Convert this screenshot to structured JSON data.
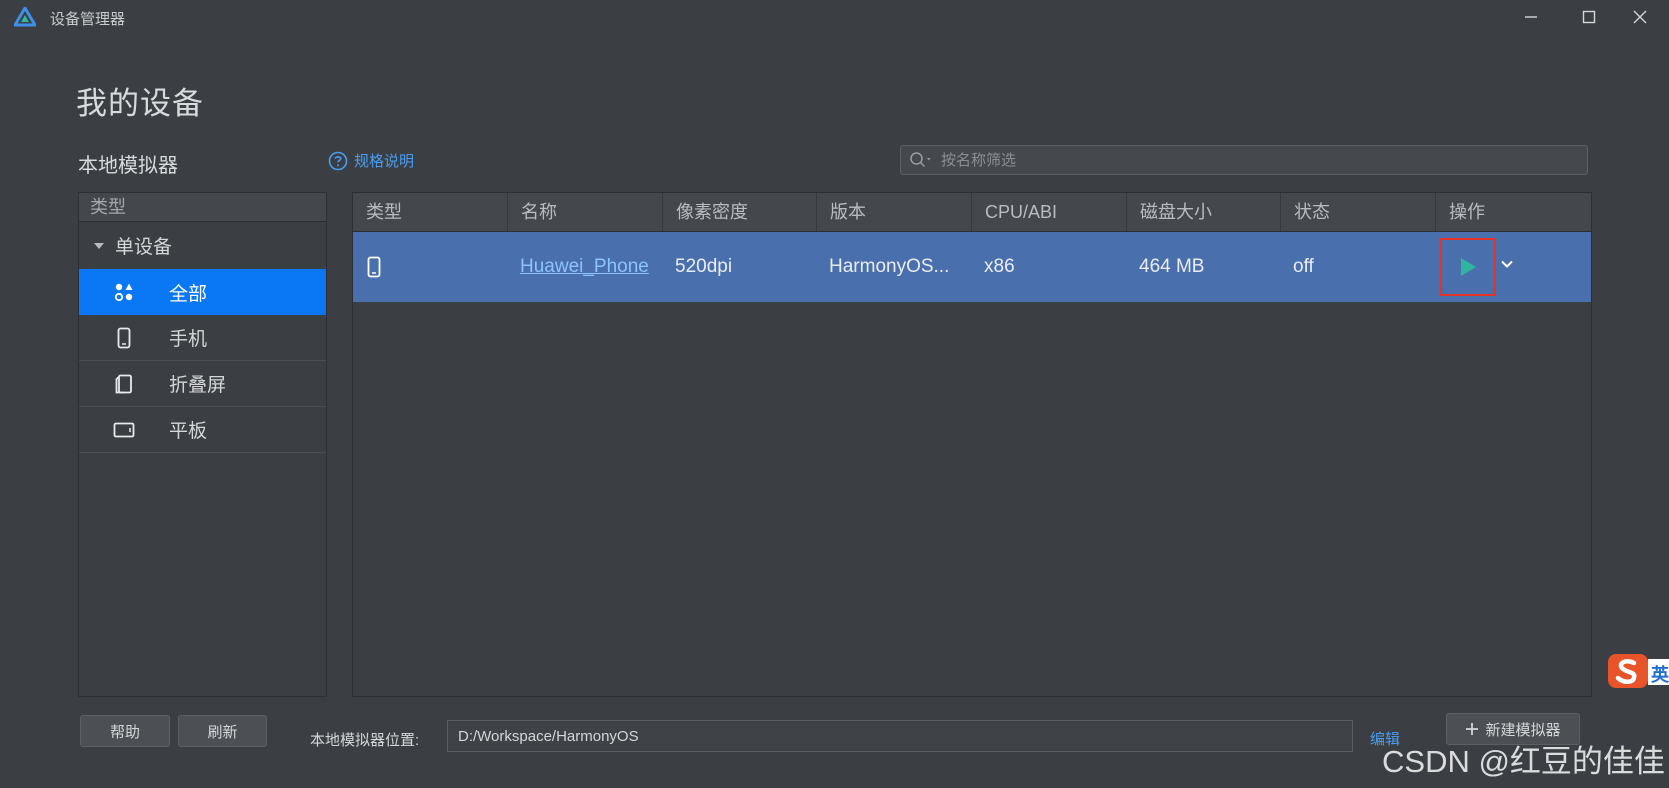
{
  "window": {
    "title": "设备管理器",
    "minimize_label": "minimize",
    "maximize_label": "maximize",
    "close_label": "close"
  },
  "page": {
    "title": "我的设备",
    "section_title": "本地模拟器",
    "spec_link": "规格说明"
  },
  "search": {
    "placeholder": "按名称筛选"
  },
  "left_panel": {
    "header": "类型",
    "group": "单设备",
    "items": [
      {
        "label": "全部",
        "icon": "all-categories-icon",
        "active": true
      },
      {
        "label": "手机",
        "icon": "phone-icon",
        "active": false
      },
      {
        "label": "折叠屏",
        "icon": "foldable-icon",
        "active": false
      },
      {
        "label": "平板",
        "icon": "tablet-icon",
        "active": false
      }
    ]
  },
  "table": {
    "columns": [
      "类型",
      "名称",
      "像素密度",
      "版本",
      "CPU/ABI",
      "磁盘大小",
      "状态",
      "操作"
    ],
    "rows": [
      {
        "type_icon": "phone-icon",
        "name": "Huawei_Phone",
        "density": "520dpi",
        "version": "HarmonyOS...",
        "cpu_abi": "x86",
        "disk_size": "464 MB",
        "status": "off",
        "actions": [
          "run-icon",
          "chevron-down-icon"
        ]
      }
    ]
  },
  "bottom": {
    "help_button": "帮助",
    "refresh_button": "刷新",
    "location_label": "本地模拟器位置:",
    "location_value": "D:/Workspace/HarmonyOS",
    "edit_link": "编辑",
    "new_emulator_button": "新建模拟器"
  },
  "watermark": "CSDN @红豆的佳佳",
  "ime_indicator": "英",
  "colors": {
    "background": "#3b3f43",
    "accent": "#0a78f5",
    "selected_row": "#4a6fad",
    "link": "#4a9cf0",
    "run_icon": "#2fb5a0",
    "highlight_box": "#e5332a"
  }
}
